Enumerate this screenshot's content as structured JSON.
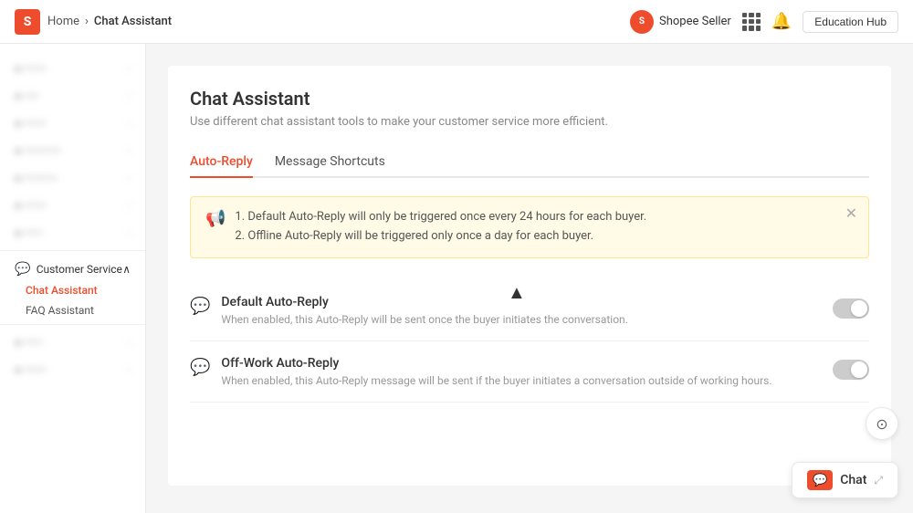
{
  "header": {
    "logo_text": "S",
    "home_label": "Home",
    "breadcrumb_sep": "›",
    "current_page": "Chat Assistant",
    "seller_name": "Shopee Seller",
    "seller_icon": "S",
    "edu_button": "Education Hub"
  },
  "sidebar": {
    "blurred_items": [
      {
        "label": "• ••••••"
      },
      {
        "label": "• ••••"
      },
      {
        "label": "• ••••••"
      },
      {
        "label": "• •••••••••••"
      },
      {
        "label": "• •••••••••"
      },
      {
        "label": "• ••••••"
      },
      {
        "label": "• •••••"
      }
    ],
    "customer_service_label": "Customer Service",
    "chat_assistant_label": "Chat Assistant",
    "faq_assistant_label": "FAQ Assistant",
    "blurred_bottom": [
      {
        "label": "• •••••"
      },
      {
        "label": "• ••••••"
      }
    ]
  },
  "main": {
    "page_title": "Chat Assistant",
    "page_subtitle": "Use different chat assistant tools to make your customer service more efficient.",
    "tabs": [
      {
        "label": "Auto-Reply",
        "active": true
      },
      {
        "label": "Message Shortcuts",
        "active": false
      }
    ],
    "alert": {
      "line1": "1. Default Auto-Reply will only be triggered once every 24 hours for each buyer.",
      "line2": "2. Offline Auto-Reply will be triggered only once a day for each buyer."
    },
    "reply_items": [
      {
        "title": "Default Auto-Reply",
        "desc": "When enabled, this Auto-Reply will be sent once the buyer initiates the conversation.",
        "enabled": false
      },
      {
        "title": "Off-Work Auto-Reply",
        "desc": "When enabled, this Auto-Reply message will be sent if the buyer initiates a conversation outside of working hours.",
        "enabled": false
      }
    ]
  },
  "chat_fab": {
    "label": "Chat",
    "expand_icon": "⤢"
  }
}
